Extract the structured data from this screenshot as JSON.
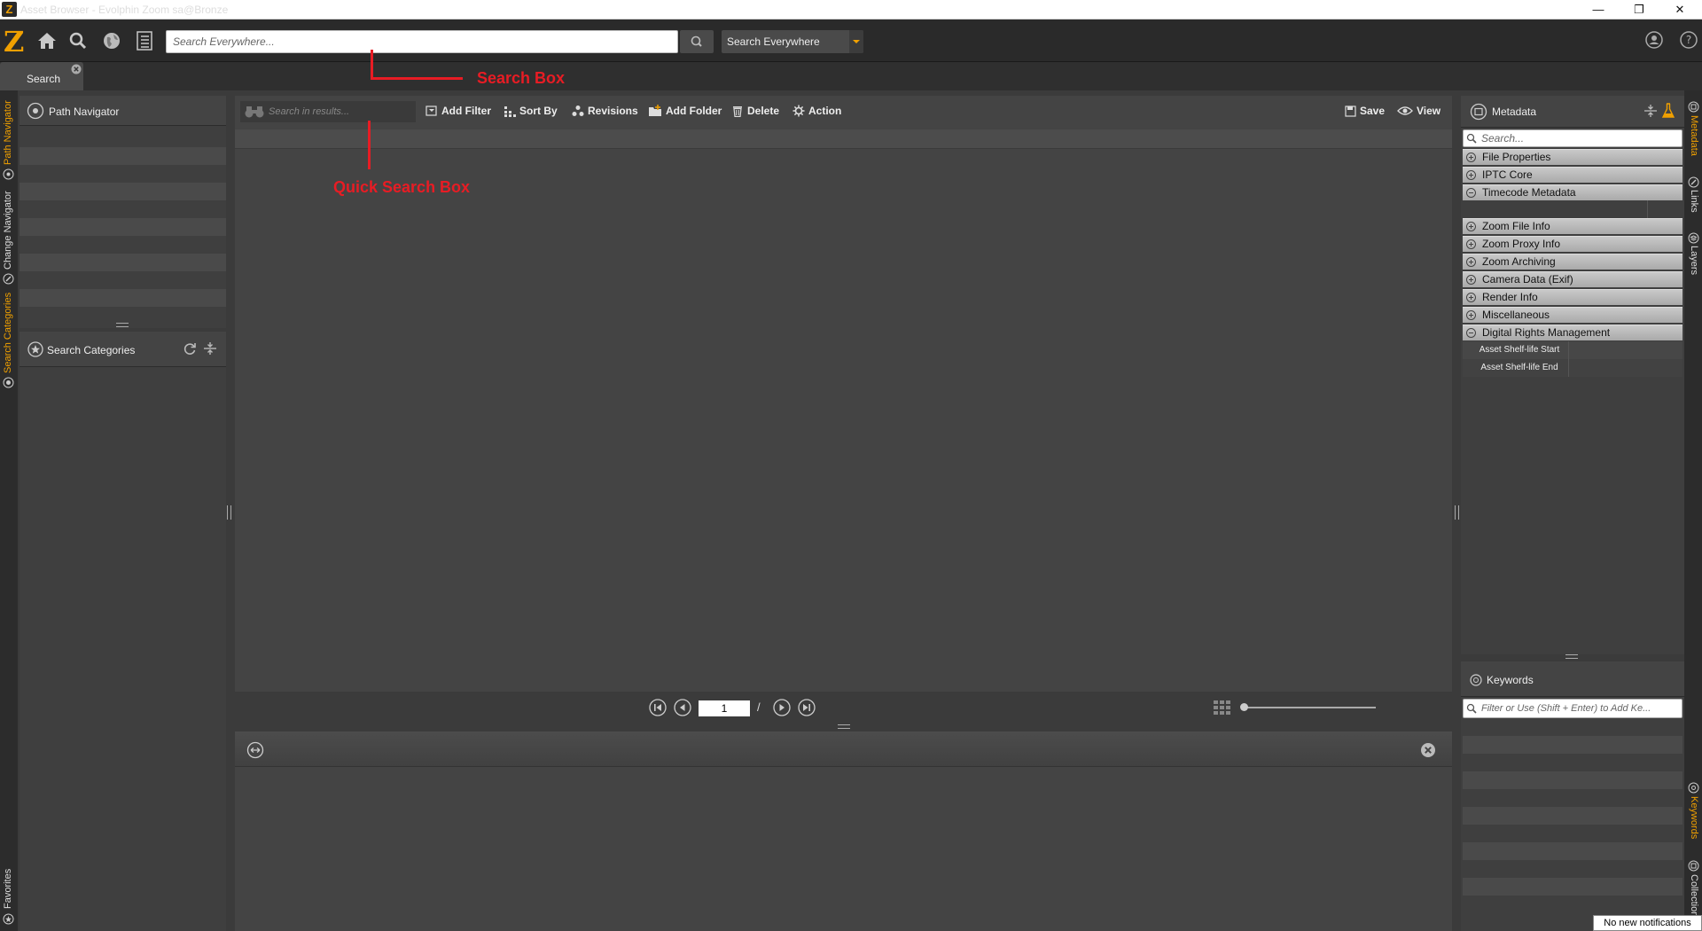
{
  "window": {
    "title": "Asset Browser - Evolphin Zoom sa@Bronze",
    "app_icon_letter": "Z",
    "controls": {
      "minimize": "—",
      "restore": "❐",
      "close": "✕"
    }
  },
  "toolbar": {
    "logo": "Z",
    "icons": [
      "home-icon",
      "search-icon",
      "globe-icon",
      "checklist-icon"
    ],
    "search_placeholder": "Search Everywhere...",
    "scope_value": "Search Everywhere",
    "right_icons": [
      "user-icon",
      "help-icon"
    ]
  },
  "tabs": [
    {
      "label": "Search"
    }
  ],
  "left_strip": {
    "tabs": [
      "Path Navigator",
      "Change Navigator",
      "Search Categories",
      "Favorites"
    ]
  },
  "path_navigator": {
    "title": "Path Navigator"
  },
  "search_categories": {
    "title": "Search Categories"
  },
  "content_toolbar": {
    "quick_search_placeholder": "Search in results...",
    "buttons": {
      "add_filter": "Add Filter",
      "sort_by": "Sort By",
      "revisions": "Revisions",
      "add_folder": "Add Folder",
      "delete": "Delete",
      "action": "Action",
      "save": "Save",
      "view": "View"
    }
  },
  "annotations": {
    "search_box": "Search Box",
    "quick_search_box": "Quick Search Box"
  },
  "pagination": {
    "page": "1",
    "separator": "/",
    "zoom_level": 0
  },
  "metadata": {
    "title": "Metadata",
    "search_placeholder": "Search...",
    "sections": [
      {
        "label": "File Properties",
        "expanded": false
      },
      {
        "label": "IPTC Core",
        "expanded": false
      },
      {
        "label": "Timecode Metadata",
        "expanded": true
      },
      {
        "label": "Zoom File Info",
        "expanded": false
      },
      {
        "label": "Zoom Proxy Info",
        "expanded": false
      },
      {
        "label": "Zoom Archiving",
        "expanded": false
      },
      {
        "label": "Camera Data (Exif)",
        "expanded": false
      },
      {
        "label": "Render Info",
        "expanded": false
      },
      {
        "label": "Miscellaneous",
        "expanded": false
      },
      {
        "label": "Digital Rights Management",
        "expanded": true
      }
    ],
    "drm_fields": [
      "Asset Shelf-life Start",
      "Asset Shelf-life End"
    ]
  },
  "keywords": {
    "title": "Keywords",
    "placeholder": "Filter or Use (Shift + Enter) to Add Ke..."
  },
  "right_strip": {
    "tabs": [
      "Metadata",
      "Links",
      "Layers",
      "Keywords",
      "Collections"
    ]
  },
  "notification": "No new notifications",
  "colors": {
    "accent": "#f0a000",
    "annotation": "#e81c24",
    "panel": "#3f3f3f",
    "background": "#2a2a2a"
  }
}
